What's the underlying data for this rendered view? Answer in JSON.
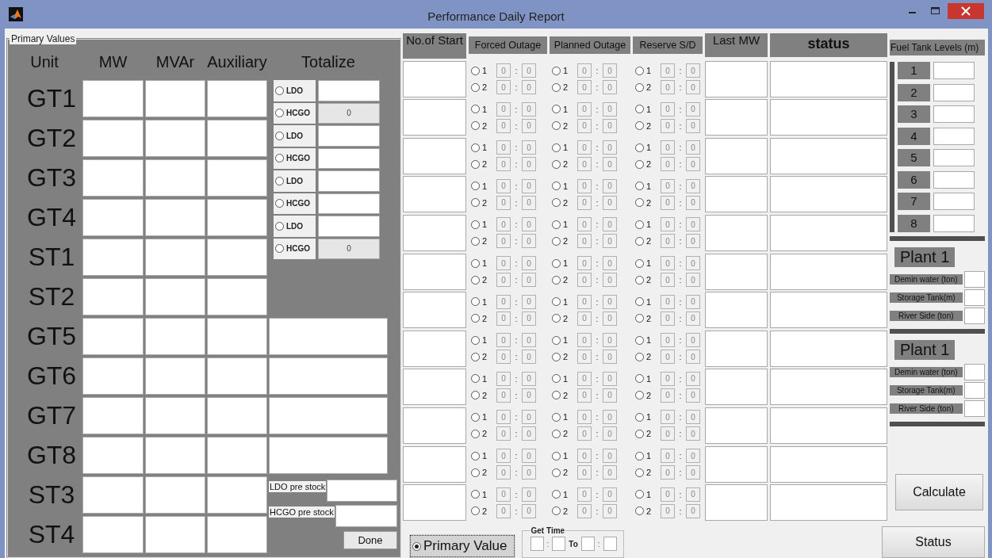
{
  "window": {
    "title": "Performance Daily Report"
  },
  "primary_values": {
    "title": "Primary Values",
    "columns": [
      "Unit",
      "MW",
      "MVAr",
      "Auxiliary",
      "Totalize"
    ],
    "units": [
      {
        "label": "GT1"
      },
      {
        "label": "GT2"
      },
      {
        "label": "GT3"
      },
      {
        "label": "GT4"
      },
      {
        "label": "ST1"
      },
      {
        "label": "ST2"
      },
      {
        "label": "GT5"
      },
      {
        "label": "GT6"
      },
      {
        "label": "GT7"
      },
      {
        "label": "GT8"
      },
      {
        "label": "ST3"
      },
      {
        "label": "ST4"
      }
    ],
    "fuel_options": [
      {
        "label": "LDO",
        "selected": false,
        "disabled": false
      },
      {
        "label": "HCGO",
        "selected": false,
        "disabled": true,
        "value": "0"
      },
      {
        "label": "LDO",
        "selected": false,
        "disabled": false
      },
      {
        "label": "HCGO",
        "selected": false,
        "disabled": false
      },
      {
        "label": "LDO",
        "selected": false,
        "disabled": false
      },
      {
        "label": "HCGO",
        "selected": false,
        "disabled": false
      },
      {
        "label": "LDO",
        "selected": false,
        "disabled": false
      },
      {
        "label": "HCGO",
        "selected": false,
        "disabled": true,
        "value": "0"
      }
    ],
    "pre_stock": [
      {
        "label": "LDO pre stock"
      },
      {
        "label": "HCGO pre stock"
      }
    ],
    "done_button": "Done"
  },
  "outages": {
    "columns": [
      "No.of Start",
      "Forced Outage",
      "Planned Outage",
      "Reserve S/D",
      "Last MW",
      "status"
    ],
    "rows": [
      {
        "forced": [
          {
            "label": "1",
            "selected": false,
            "hours": "0",
            "sep": ":",
            "minutes": "0"
          },
          {
            "label": "2",
            "selected": false,
            "hours": "0",
            "sep": ":",
            "minutes": "0"
          }
        ],
        "planned": [
          {
            "label": "1",
            "selected": false,
            "hours": "0",
            "sep": ":",
            "minutes": "0"
          },
          {
            "label": "2",
            "selected": false,
            "hours": "0",
            "sep": ":",
            "minutes": "0"
          }
        ],
        "reserve": [
          {
            "label": "1",
            "selected": false,
            "hours": "0",
            "sep": ":",
            "minutes": "0"
          },
          {
            "label": "2",
            "selected": false,
            "hours": "0",
            "sep": ":",
            "minutes": "0"
          }
        ]
      },
      {
        "forced": [
          {
            "label": "1",
            "selected": false,
            "hours": "0",
            "sep": ":",
            "minutes": "0"
          },
          {
            "label": "2",
            "selected": false,
            "hours": "0",
            "sep": ":",
            "minutes": "0"
          }
        ],
        "planned": [
          {
            "label": "1",
            "selected": false,
            "hours": "0",
            "sep": ":",
            "minutes": "0"
          },
          {
            "label": "2",
            "selected": false,
            "hours": "0",
            "sep": ":",
            "minutes": "0"
          }
        ],
        "reserve": [
          {
            "label": "1",
            "selected": false,
            "hours": "0",
            "sep": ":",
            "minutes": "0"
          },
          {
            "label": "2",
            "selected": false,
            "hours": "0",
            "sep": ":",
            "minutes": "0"
          }
        ]
      },
      {
        "forced": [
          {
            "label": "1",
            "selected": false,
            "hours": "0",
            "sep": ":",
            "minutes": "0"
          },
          {
            "label": "2",
            "selected": false,
            "hours": "0",
            "sep": ":",
            "minutes": "0"
          }
        ],
        "planned": [
          {
            "label": "1",
            "selected": false,
            "hours": "0",
            "sep": ":",
            "minutes": "0"
          },
          {
            "label": "2",
            "selected": false,
            "hours": "0",
            "sep": ":",
            "minutes": "0"
          }
        ],
        "reserve": [
          {
            "label": "1",
            "selected": false,
            "hours": "0",
            "sep": ":",
            "minutes": "0"
          },
          {
            "label": "2",
            "selected": false,
            "hours": "0",
            "sep": ":",
            "minutes": "0"
          }
        ]
      },
      {
        "forced": [
          {
            "label": "1",
            "selected": false,
            "hours": "0",
            "sep": ":",
            "minutes": "0"
          },
          {
            "label": "2",
            "selected": false,
            "hours": "0",
            "sep": ":",
            "minutes": "0"
          }
        ],
        "planned": [
          {
            "label": "1",
            "selected": false,
            "hours": "0",
            "sep": ":",
            "minutes": "0"
          },
          {
            "label": "2",
            "selected": false,
            "hours": "0",
            "sep": ":",
            "minutes": "0"
          }
        ],
        "reserve": [
          {
            "label": "1",
            "selected": false,
            "hours": "0",
            "sep": ":",
            "minutes": "0"
          },
          {
            "label": "2",
            "selected": false,
            "hours": "0",
            "sep": ":",
            "minutes": "0"
          }
        ]
      },
      {
        "forced": [
          {
            "label": "1",
            "selected": false,
            "hours": "0",
            "sep": ":",
            "minutes": "0"
          },
          {
            "label": "2",
            "selected": false,
            "hours": "0",
            "sep": ":",
            "minutes": "0"
          }
        ],
        "planned": [
          {
            "label": "1",
            "selected": false,
            "hours": "0",
            "sep": ":",
            "minutes": "0"
          },
          {
            "label": "2",
            "selected": false,
            "hours": "0",
            "sep": ":",
            "minutes": "0"
          }
        ],
        "reserve": [
          {
            "label": "1",
            "selected": false,
            "hours": "0",
            "sep": ":",
            "minutes": "0"
          },
          {
            "label": "2",
            "selected": false,
            "hours": "0",
            "sep": ":",
            "minutes": "0"
          }
        ]
      },
      {
        "forced": [
          {
            "label": "1",
            "selected": false,
            "hours": "0",
            "sep": ":",
            "minutes": "0"
          },
          {
            "label": "2",
            "selected": false,
            "hours": "0",
            "sep": ":",
            "minutes": "0"
          }
        ],
        "planned": [
          {
            "label": "1",
            "selected": false,
            "hours": "0",
            "sep": ":",
            "minutes": "0"
          },
          {
            "label": "2",
            "selected": false,
            "hours": "0",
            "sep": ":",
            "minutes": "0"
          }
        ],
        "reserve": [
          {
            "label": "1",
            "selected": false,
            "hours": "0",
            "sep": ":",
            "minutes": "0"
          },
          {
            "label": "2",
            "selected": false,
            "hours": "0",
            "sep": ":",
            "minutes": "0"
          }
        ]
      },
      {
        "forced": [
          {
            "label": "1",
            "selected": false,
            "hours": "0",
            "sep": ":",
            "minutes": "0"
          },
          {
            "label": "2",
            "selected": false,
            "hours": "0",
            "sep": ":",
            "minutes": "0"
          }
        ],
        "planned": [
          {
            "label": "1",
            "selected": false,
            "hours": "0",
            "sep": ":",
            "minutes": "0"
          },
          {
            "label": "2",
            "selected": false,
            "hours": "0",
            "sep": ":",
            "minutes": "0"
          }
        ],
        "reserve": [
          {
            "label": "1",
            "selected": false,
            "hours": "0",
            "sep": ":",
            "minutes": "0"
          },
          {
            "label": "2",
            "selected": false,
            "hours": "0",
            "sep": ":",
            "minutes": "0"
          }
        ]
      },
      {
        "forced": [
          {
            "label": "1",
            "selected": false,
            "hours": "0",
            "sep": ":",
            "minutes": "0"
          },
          {
            "label": "2",
            "selected": false,
            "hours": "0",
            "sep": ":",
            "minutes": "0"
          }
        ],
        "planned": [
          {
            "label": "1",
            "selected": false,
            "hours": "0",
            "sep": ":",
            "minutes": "0"
          },
          {
            "label": "2",
            "selected": false,
            "hours": "0",
            "sep": ":",
            "minutes": "0"
          }
        ],
        "reserve": [
          {
            "label": "1",
            "selected": false,
            "hours": "0",
            "sep": ":",
            "minutes": "0"
          },
          {
            "label": "2",
            "selected": false,
            "hours": "0",
            "sep": ":",
            "minutes": "0"
          }
        ]
      },
      {
        "forced": [
          {
            "label": "1",
            "selected": false,
            "hours": "0",
            "sep": ":",
            "minutes": "0"
          },
          {
            "label": "2",
            "selected": false,
            "hours": "0",
            "sep": ":",
            "minutes": "0"
          }
        ],
        "planned": [
          {
            "label": "1",
            "selected": false,
            "hours": "0",
            "sep": ":",
            "minutes": "0"
          },
          {
            "label": "2",
            "selected": false,
            "hours": "0",
            "sep": ":",
            "minutes": "0"
          }
        ],
        "reserve": [
          {
            "label": "1",
            "selected": false,
            "hours": "0",
            "sep": ":",
            "minutes": "0"
          },
          {
            "label": "2",
            "selected": false,
            "hours": "0",
            "sep": ":",
            "minutes": "0"
          }
        ]
      },
      {
        "forced": [
          {
            "label": "1",
            "selected": false,
            "hours": "0",
            "sep": ":",
            "minutes": "0"
          },
          {
            "label": "2",
            "selected": false,
            "hours": "0",
            "sep": ":",
            "minutes": "0"
          }
        ],
        "planned": [
          {
            "label": "1",
            "selected": false,
            "hours": "0",
            "sep": ":",
            "minutes": "0"
          },
          {
            "label": "2",
            "selected": false,
            "hours": "0",
            "sep": ":",
            "minutes": "0"
          }
        ],
        "reserve": [
          {
            "label": "1",
            "selected": false,
            "hours": "0",
            "sep": ":",
            "minutes": "0"
          },
          {
            "label": "2",
            "selected": false,
            "hours": "0",
            "sep": ":",
            "minutes": "0"
          }
        ]
      },
      {
        "forced": [
          {
            "label": "1",
            "selected": false,
            "hours": "0",
            "sep": ":",
            "minutes": "0"
          },
          {
            "label": "2",
            "selected": false,
            "hours": "0",
            "sep": ":",
            "minutes": "0"
          }
        ],
        "planned": [
          {
            "label": "1",
            "selected": false,
            "hours": "0",
            "sep": ":",
            "minutes": "0"
          },
          {
            "label": "2",
            "selected": false,
            "hours": "0",
            "sep": ":",
            "minutes": "0"
          }
        ],
        "reserve": [
          {
            "label": "1",
            "selected": false,
            "hours": "0",
            "sep": ":",
            "minutes": "0"
          },
          {
            "label": "2",
            "selected": false,
            "hours": "0",
            "sep": ":",
            "minutes": "0"
          }
        ]
      },
      {
        "forced": [
          {
            "label": "1",
            "selected": false,
            "hours": "0",
            "sep": ":",
            "minutes": "0"
          },
          {
            "label": "2",
            "selected": false,
            "hours": "0",
            "sep": ":",
            "minutes": "0"
          }
        ],
        "planned": [
          {
            "label": "1",
            "selected": false,
            "hours": "0",
            "sep": ":",
            "minutes": "0"
          },
          {
            "label": "2",
            "selected": false,
            "hours": "0",
            "sep": ":",
            "minutes": "0"
          }
        ],
        "reserve": [
          {
            "label": "1",
            "selected": false,
            "hours": "0",
            "sep": ":",
            "minutes": "0"
          },
          {
            "label": "2",
            "selected": false,
            "hours": "0",
            "sep": ":",
            "minutes": "0"
          }
        ]
      }
    ]
  },
  "mode_option": {
    "label": "Primary Value",
    "selected": true
  },
  "get_time": {
    "title": "Get Time",
    "separators": [
      ":",
      "To",
      ":"
    ]
  },
  "fuel_tanks": {
    "title": "Fuel Tank Levels (m)",
    "tanks": [
      {
        "label": "1"
      },
      {
        "label": "2"
      },
      {
        "label": "3"
      },
      {
        "label": "4"
      },
      {
        "label": "5"
      },
      {
        "label": "6"
      },
      {
        "label": "7"
      },
      {
        "label": "8"
      }
    ]
  },
  "plants": [
    {
      "title": "Plant 1",
      "fields": [
        {
          "label": "Demin water (ton)"
        },
        {
          "label": "Storage Tank(m)"
        },
        {
          "label": "River Side (ton)"
        }
      ]
    },
    {
      "title": "Plant 1",
      "fields": [
        {
          "label": "Demin water (ton)"
        },
        {
          "label": "Storage Tank(m)"
        },
        {
          "label": "River Side (ton)"
        }
      ]
    }
  ],
  "buttons": [
    {
      "label": "Calculate"
    },
    {
      "label": "Status"
    }
  ]
}
